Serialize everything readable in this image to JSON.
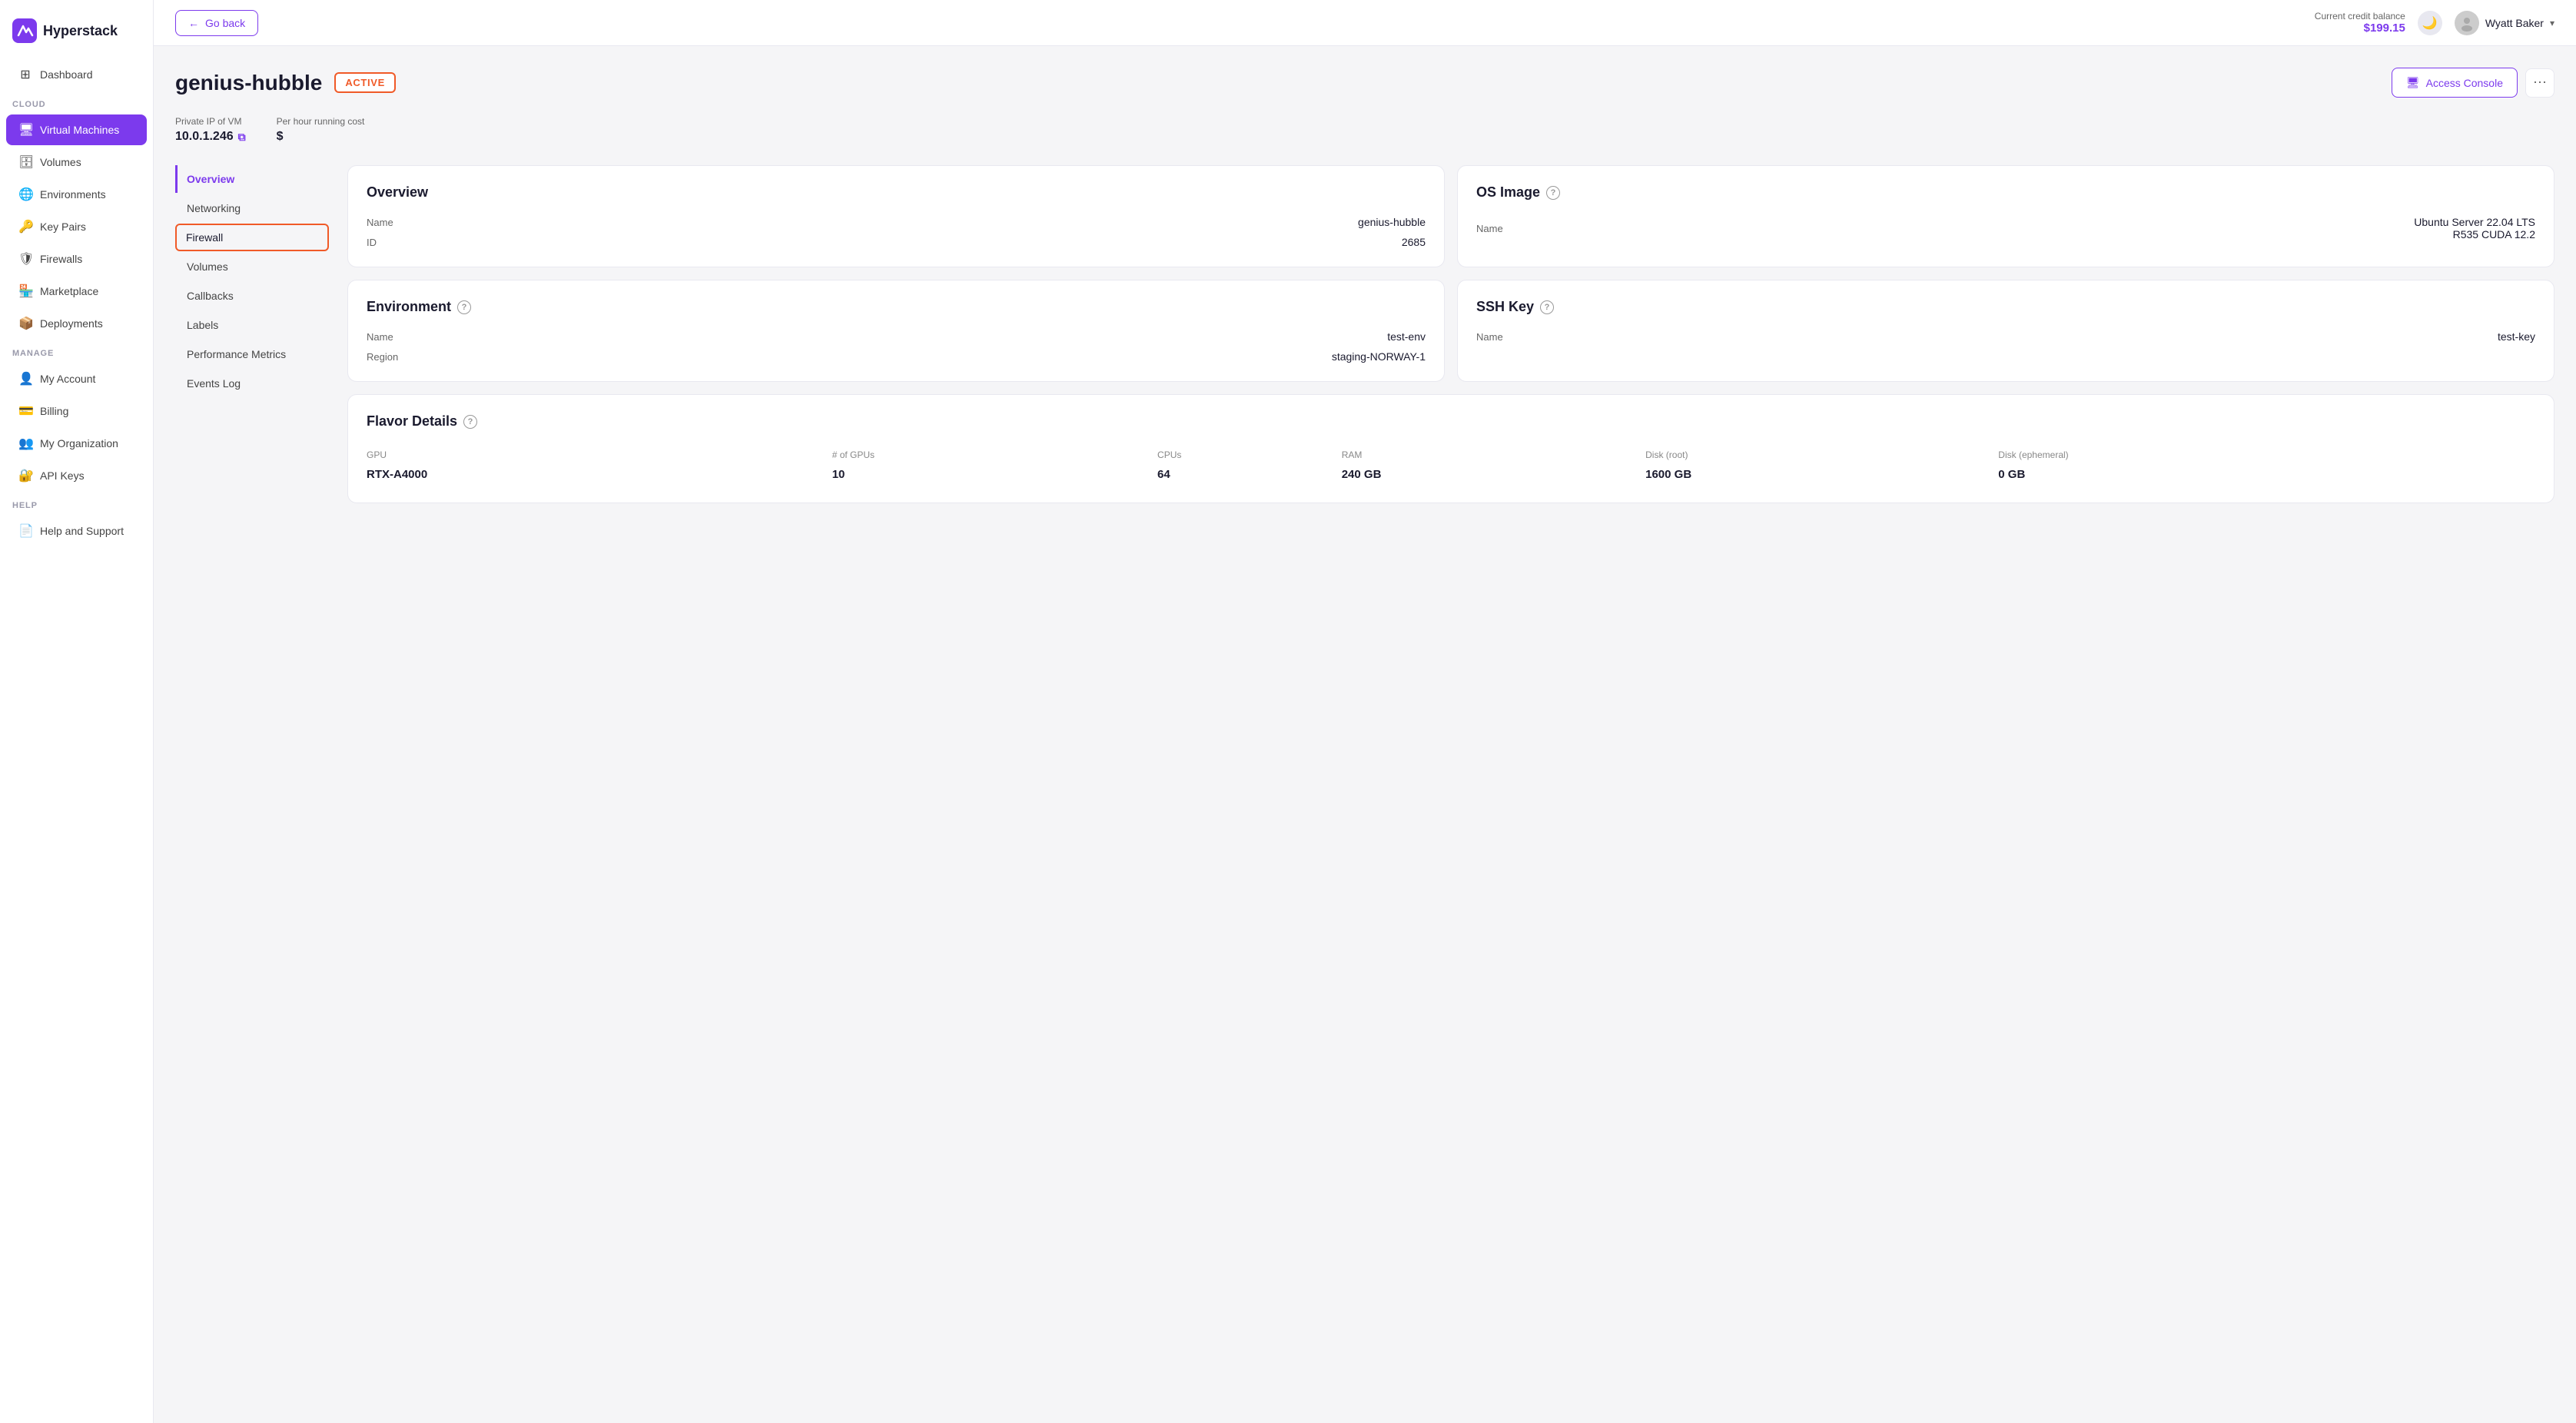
{
  "sidebar": {
    "logo_text": "Hyperstack",
    "sections": [
      {
        "label": "",
        "items": [
          {
            "id": "dashboard",
            "label": "Dashboard",
            "icon": "⊞",
            "active": false
          }
        ]
      },
      {
        "label": "CLOUD",
        "items": [
          {
            "id": "virtual-machines",
            "label": "Virtual Machines",
            "icon": "🖥",
            "active": true
          },
          {
            "id": "volumes",
            "label": "Volumes",
            "icon": "🗄",
            "active": false
          },
          {
            "id": "environments",
            "label": "Environments",
            "icon": "🌐",
            "active": false
          },
          {
            "id": "key-pairs",
            "label": "Key Pairs",
            "icon": "🔑",
            "active": false
          },
          {
            "id": "firewalls",
            "label": "Firewalls",
            "icon": "🛡",
            "active": false
          },
          {
            "id": "marketplace",
            "label": "Marketplace",
            "icon": "🏪",
            "active": false
          },
          {
            "id": "deployments",
            "label": "Deployments",
            "icon": "📦",
            "active": false
          }
        ]
      },
      {
        "label": "MANAGE",
        "items": [
          {
            "id": "my-account",
            "label": "My Account",
            "icon": "👤",
            "active": false
          },
          {
            "id": "billing",
            "label": "Billing",
            "icon": "💳",
            "active": false
          },
          {
            "id": "my-organization",
            "label": "My Organization",
            "icon": "👥",
            "active": false
          },
          {
            "id": "api-keys",
            "label": "API Keys",
            "icon": "🔐",
            "active": false
          }
        ]
      },
      {
        "label": "HELP",
        "items": [
          {
            "id": "help-support",
            "label": "Help and Support",
            "icon": "📄",
            "active": false
          }
        ]
      }
    ]
  },
  "header": {
    "go_back_label": "Go back",
    "credit_label": "Current credit balance",
    "credit_amount": "$199.15",
    "theme_icon": "🌙",
    "user_name": "Wyatt Baker"
  },
  "vm": {
    "name": "genius-hubble",
    "status": "ACTIVE",
    "private_ip_label": "Private IP of VM",
    "private_ip": "10.0.1.246",
    "cost_label": "Per hour running cost",
    "cost": "$"
  },
  "nav_items": [
    {
      "id": "overview",
      "label": "Overview",
      "active": true,
      "highlighted": false
    },
    {
      "id": "networking",
      "label": "Networking",
      "active": false,
      "highlighted": false
    },
    {
      "id": "firewall",
      "label": "Firewall",
      "active": false,
      "highlighted": true
    },
    {
      "id": "volumes",
      "label": "Volumes",
      "active": false,
      "highlighted": false
    },
    {
      "id": "callbacks",
      "label": "Callbacks",
      "active": false,
      "highlighted": false
    },
    {
      "id": "labels",
      "label": "Labels",
      "active": false,
      "highlighted": false
    },
    {
      "id": "performance-metrics",
      "label": "Performance Metrics",
      "active": false,
      "highlighted": false
    },
    {
      "id": "events-log",
      "label": "Events Log",
      "active": false,
      "highlighted": false
    }
  ],
  "cards": {
    "overview": {
      "title": "Overview",
      "rows": [
        {
          "key": "Name",
          "value": "genius-hubble"
        },
        {
          "key": "ID",
          "value": "2685"
        }
      ]
    },
    "os_image": {
      "title": "OS Image",
      "has_info": true,
      "rows": [
        {
          "key": "Name",
          "value": "Ubuntu Server 22.04 LTS\nR535 CUDA 12.2"
        }
      ]
    },
    "environment": {
      "title": "Environment",
      "has_info": true,
      "rows": [
        {
          "key": "Name",
          "value": "test-env"
        },
        {
          "key": "Region",
          "value": "staging-NORWAY-1"
        }
      ]
    },
    "ssh_key": {
      "title": "SSH Key",
      "has_info": true,
      "rows": [
        {
          "key": "Name",
          "value": "test-key"
        }
      ]
    },
    "flavor": {
      "title": "Flavor Details",
      "has_info": true,
      "gpu": "RTX-A4000",
      "num_gpus": "10",
      "cpus": "64",
      "ram": "240 GB",
      "disk_root": "1600 GB",
      "disk_ephemeral": "0 GB",
      "col_headers": [
        "GPU",
        "# of GPUs",
        "CPUs",
        "RAM",
        "Disk (root)",
        "Disk (ephemeral)"
      ]
    }
  },
  "buttons": {
    "access_console": "Access Console",
    "more_icon": "⋯"
  }
}
